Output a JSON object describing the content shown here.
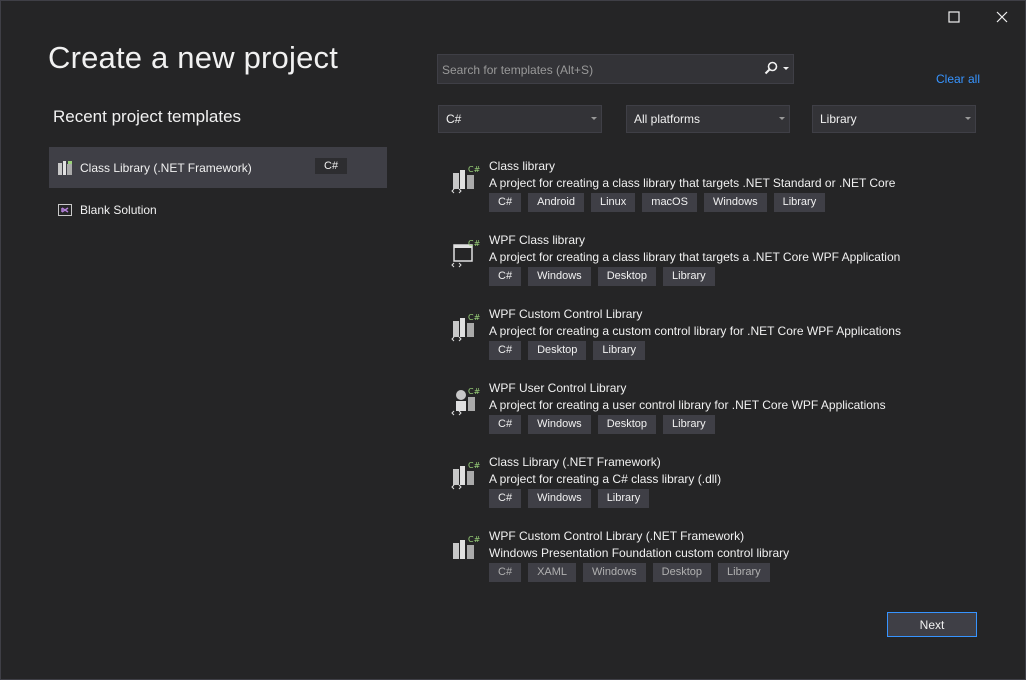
{
  "window": {
    "buttons": [
      "maximize",
      "close"
    ]
  },
  "page_title": "Create a new project",
  "recent": {
    "heading": "Recent project templates",
    "items": [
      {
        "label": "Class Library (.NET Framework)",
        "lang": "C#",
        "icon": "class-library-icon",
        "selected": true
      },
      {
        "label": "Blank Solution",
        "lang": "",
        "icon": "solution-icon",
        "selected": false
      }
    ]
  },
  "search": {
    "placeholder": "Search for templates (Alt+S)",
    "value": ""
  },
  "clear_all": "Clear all",
  "filters": {
    "language": "C#",
    "platform": "All platforms",
    "project_type": "Library"
  },
  "templates": [
    {
      "name": "Class library",
      "description": "A project for creating a class library that targets .NET Standard or .NET Core",
      "tags": [
        "C#",
        "Android",
        "Linux",
        "macOS",
        "Windows",
        "Library"
      ],
      "icon": "class-library-csharp-icon"
    },
    {
      "name": "WPF Class library",
      "description": "A project for creating a class library that targets a .NET Core WPF Application",
      "tags": [
        "C#",
        "Windows",
        "Desktop",
        "Library"
      ],
      "icon": "wpf-window-icon"
    },
    {
      "name": "WPF Custom Control Library",
      "description": "A project for creating a custom control library for .NET Core WPF Applications",
      "tags": [
        "C#",
        "Desktop",
        "Library"
      ],
      "icon": "custom-control-library-icon"
    },
    {
      "name": "WPF User Control Library",
      "description": "A project for creating a user control library for .NET Core WPF Applications",
      "tags": [
        "C#",
        "Windows",
        "Desktop",
        "Library"
      ],
      "icon": "user-control-library-icon"
    },
    {
      "name": "Class Library (.NET Framework)",
      "description": "A project for creating a C# class library (.dll)",
      "tags": [
        "C#",
        "Windows",
        "Library"
      ],
      "icon": "class-library-framework-icon"
    },
    {
      "name": "WPF Custom Control Library (.NET Framework)",
      "description": "Windows Presentation Foundation custom control library",
      "tags": [
        "C#",
        "XAML",
        "Windows",
        "Desktop",
        "Library"
      ],
      "icon": "custom-control-framework-icon"
    }
  ],
  "footer": {
    "next_label": "Next"
  },
  "colors": {
    "background": "#252526",
    "panel": "#3f3f46",
    "accent": "#3794ff",
    "csharp_green": "#9ad27a"
  }
}
